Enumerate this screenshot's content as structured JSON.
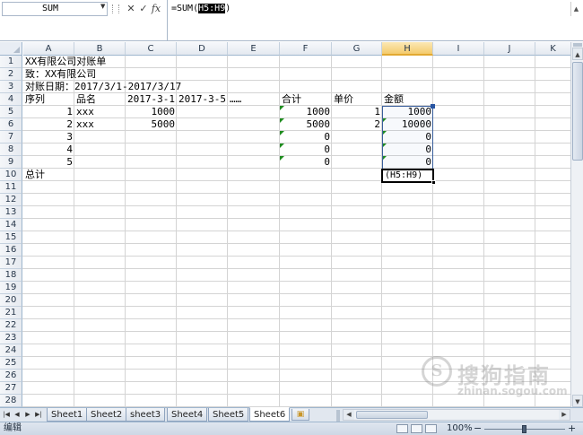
{
  "formula_bar": {
    "name_box": "SUM",
    "cancel_icon": "✕",
    "enter_icon": "✓",
    "fx_label": "fx",
    "formula_prefix": "=SUM(",
    "formula_ref": "H5:H9",
    "formula_suffix": ")"
  },
  "columns": [
    "A",
    "B",
    "C",
    "D",
    "E",
    "F",
    "G",
    "H",
    "I",
    "J",
    "K"
  ],
  "selected_column": "H",
  "rows": [
    "1",
    "2",
    "3",
    "4",
    "5",
    "6",
    "7",
    "8",
    "9",
    "10",
    "11",
    "12",
    "13",
    "14",
    "15",
    "16",
    "17",
    "18",
    "19",
    "20",
    "21",
    "22",
    "23",
    "24",
    "25",
    "26",
    "27",
    "28"
  ],
  "cells": {
    "A1": "XX有限公司对账单",
    "A2": "致：XX有限公司",
    "A3": "对账日期：2017/3/1-2017/3/17",
    "A4": "序列",
    "B4": "品名",
    "C4": "2017-3-1",
    "D4": "2017-3-5",
    "E4": "……",
    "F4": "合计",
    "G4": "单价",
    "H4": "金额",
    "A5": "1",
    "B5": "xxx",
    "C5": "1000",
    "F5": "1000",
    "G5": "1",
    "H5": "1000",
    "A6": "2",
    "B6": "xxx",
    "C6": "5000",
    "F6": "5000",
    "G6": "2",
    "H6": "10000",
    "A7": "3",
    "F7": "0",
    "H7": "0",
    "A8": "4",
    "F8": "0",
    "H8": "0",
    "A9": "5",
    "F9": "0",
    "H9": "0",
    "A10": "总计",
    "H10": "(H5:H9)"
  },
  "sheet_tabs": [
    "Sheet1",
    "Sheet2",
    "sheet3",
    "Sheet4",
    "Sheet5",
    "Sheet6"
  ],
  "active_sheet": "Sheet6",
  "status": {
    "mode": "编辑",
    "zoom": "100%",
    "zoom_minus": "−",
    "zoom_plus": "+"
  },
  "watermark": {
    "logo_letter": "S",
    "text": "搜狗指南",
    "url": "zhinan.sogou.com"
  },
  "icons": {
    "nav_first": "first-sheet-icon",
    "nav_prev": "prev-sheet-icon",
    "nav_next": "next-sheet-icon",
    "nav_last": "last-sheet-icon",
    "new_sheet": "new-sheet-icon"
  }
}
